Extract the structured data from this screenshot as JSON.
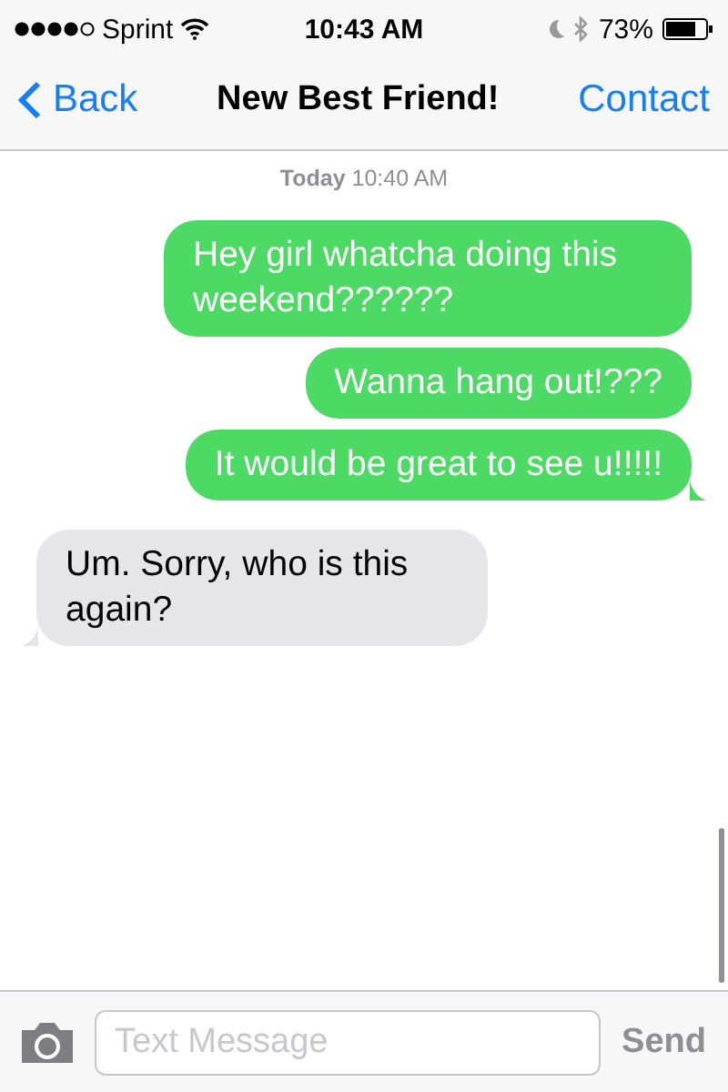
{
  "status_bar": {
    "carrier": "Sprint",
    "time": "10:43 AM",
    "battery": "73%"
  },
  "nav": {
    "back": "Back",
    "title": "New Best Friend!",
    "action": "Contact"
  },
  "timestamp": "**Today** 10:40 AM",
  "messages": [
    {
      "kind": "sent",
      "text": "Hey girl whatcha doing this weekend??????",
      "tail": false
    },
    {
      "kind": "sent",
      "text": "Wanna hang out!???",
      "tail": false
    },
    {
      "kind": "sent",
      "text": "It would be great to see u!!!!!",
      "tail": true
    },
    {
      "kind": "received",
      "text": "Um. Sorry, who is this again?",
      "tail": true
    }
  ],
  "composer": {
    "placeholder": "Text Message",
    "send": "Send",
    "disabled": true
  }
}
